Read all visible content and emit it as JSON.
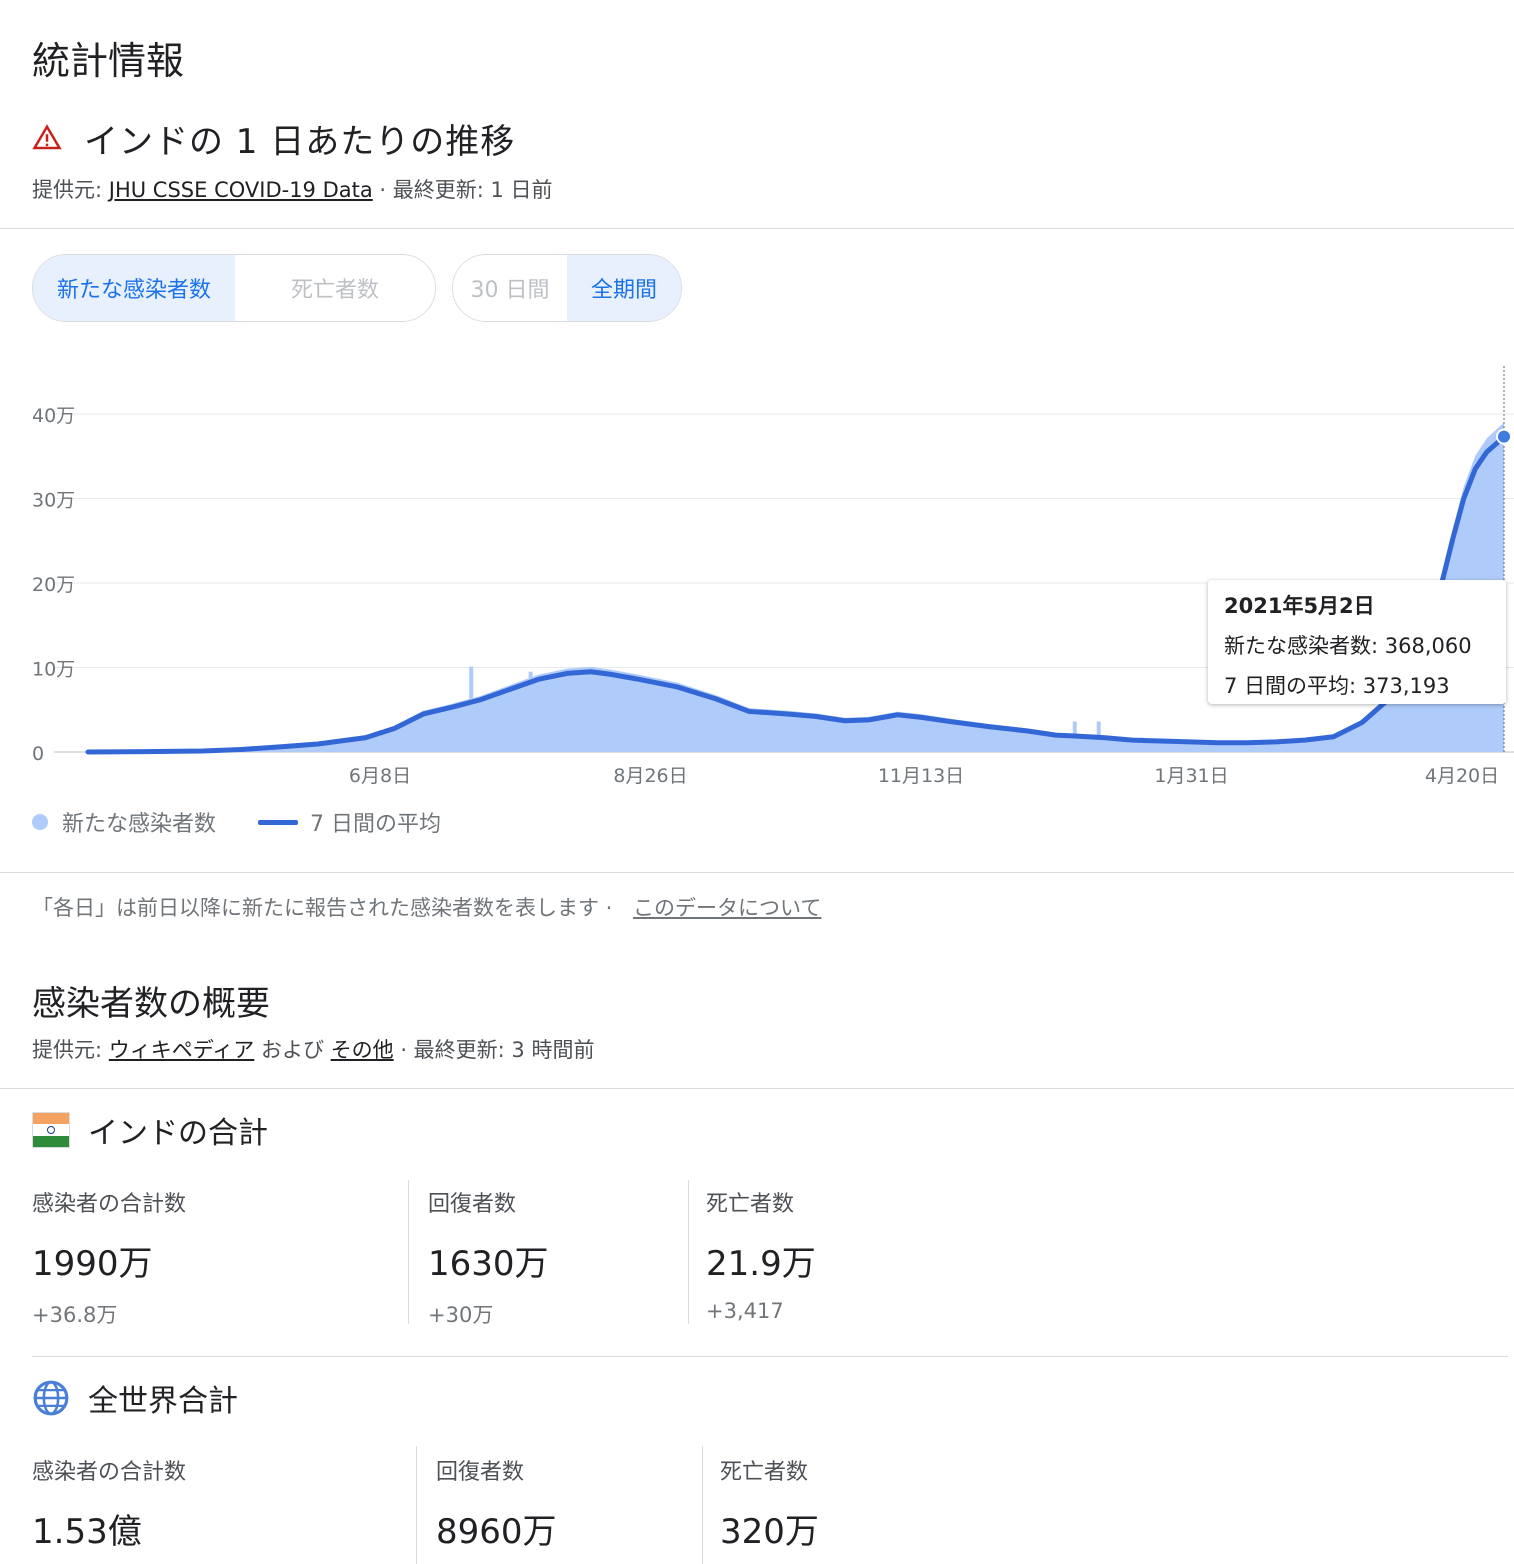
{
  "section_title": "統計情報",
  "trend": {
    "title": "インドの 1 日あたりの推移",
    "source_prefix": "提供元: ",
    "source_link": "JHU CSSE COVID-19 Data",
    "updated": " · 最終更新: 1 日前"
  },
  "toggles": {
    "metric": [
      {
        "label": "新たな感染者数",
        "active": true
      },
      {
        "label": "死亡者数",
        "active": false
      }
    ],
    "range": [
      {
        "label": "30 日間",
        "active": false
      },
      {
        "label": "全期間",
        "active": true
      }
    ]
  },
  "chart_data": {
    "type": "bar",
    "title": "",
    "xlabel": "",
    "ylabel": "",
    "ylim": [
      0,
      400000
    ],
    "y_ticks": [
      {
        "value": 0,
        "label": "0"
      },
      {
        "value": 100000,
        "label": "10万"
      },
      {
        "value": 200000,
        "label": "20万"
      },
      {
        "value": 300000,
        "label": "30万"
      },
      {
        "value": 400000,
        "label": "40万"
      }
    ],
    "x_ticks": [
      "6月8日",
      "8月26日",
      "11月13日",
      "1月31日",
      "4月20日"
    ],
    "series": [
      {
        "name": "新たな感染者数",
        "kind": "bar",
        "color": "#aecbfa"
      },
      {
        "name": "7 日間の平均",
        "kind": "line",
        "color": "#3367d6"
      }
    ],
    "avg_points": [
      [
        0,
        0
      ],
      [
        60,
        400
      ],
      [
        120,
        1200
      ],
      [
        160,
        3000
      ],
      [
        200,
        6000
      ],
      [
        240,
        9500
      ],
      [
        290,
        17000
      ],
      [
        320,
        28000
      ],
      [
        350,
        45000
      ],
      [
        380,
        53000
      ],
      [
        410,
        62000
      ],
      [
        440,
        74000
      ],
      [
        470,
        86000
      ],
      [
        500,
        93000
      ],
      [
        525,
        95000
      ],
      [
        545,
        92000
      ],
      [
        575,
        86000
      ],
      [
        615,
        77000
      ],
      [
        655,
        63000
      ],
      [
        690,
        48000
      ],
      [
        730,
        45000
      ],
      [
        760,
        42000
      ],
      [
        790,
        37000
      ],
      [
        815,
        38000
      ],
      [
        845,
        44000
      ],
      [
        870,
        41000
      ],
      [
        900,
        36000
      ],
      [
        940,
        30000
      ],
      [
        980,
        25000
      ],
      [
        1010,
        20000
      ],
      [
        1030,
        19000
      ],
      [
        1060,
        17000
      ],
      [
        1090,
        14000
      ],
      [
        1120,
        13000
      ],
      [
        1150,
        12000
      ],
      [
        1180,
        11000
      ],
      [
        1210,
        11000
      ],
      [
        1240,
        12000
      ],
      [
        1270,
        14000
      ],
      [
        1300,
        18000
      ],
      [
        1330,
        35000
      ],
      [
        1360,
        65000
      ],
      [
        1385,
        105000
      ],
      [
        1400,
        150000
      ],
      [
        1412,
        195000
      ],
      [
        1424,
        250000
      ],
      [
        1436,
        300000
      ],
      [
        1448,
        335000
      ],
      [
        1460,
        355000
      ],
      [
        1470,
        365000
      ],
      [
        1478,
        373193
      ]
    ],
    "bar_spikes": [
      [
        400,
        101000
      ],
      [
        462,
        95000
      ],
      [
        1030,
        36000
      ],
      [
        1055,
        36000
      ],
      [
        1100,
        17000
      ]
    ],
    "x_range_days": [
      0,
      1478
    ],
    "tooltip": {
      "date": "2021年5月2日",
      "new_cases_label": "新たな感染者数: ",
      "new_cases": "368,060",
      "avg_label": "7 日間の平均: ",
      "avg": "373,193"
    }
  },
  "footnote": {
    "text": "「各日」は前日以降に新たに報告された感染者数を表します ·",
    "link": "このデータについて"
  },
  "overview": {
    "title": "感染者数の概要",
    "source_prefix": "提供元: ",
    "source_link1": "ウィキペディア",
    "and": " および ",
    "source_link2": "その他",
    "updated": " · 最終更新: 3 時間前"
  },
  "india": {
    "name": "インドの合計",
    "stats": [
      {
        "label": "感染者の合計数",
        "value": "1990万",
        "delta": "+36.8万"
      },
      {
        "label": "回復者数",
        "value": "1630万",
        "delta": "+30万"
      },
      {
        "label": "死亡者数",
        "value": "21.9万",
        "delta": "+3,417"
      }
    ]
  },
  "world": {
    "name": "全世界合計",
    "stats": [
      {
        "label": "感染者の合計数",
        "value": "1.53億"
      },
      {
        "label": "回復者数",
        "value": "8960万"
      },
      {
        "label": "死亡者数",
        "value": "320万"
      }
    ]
  }
}
